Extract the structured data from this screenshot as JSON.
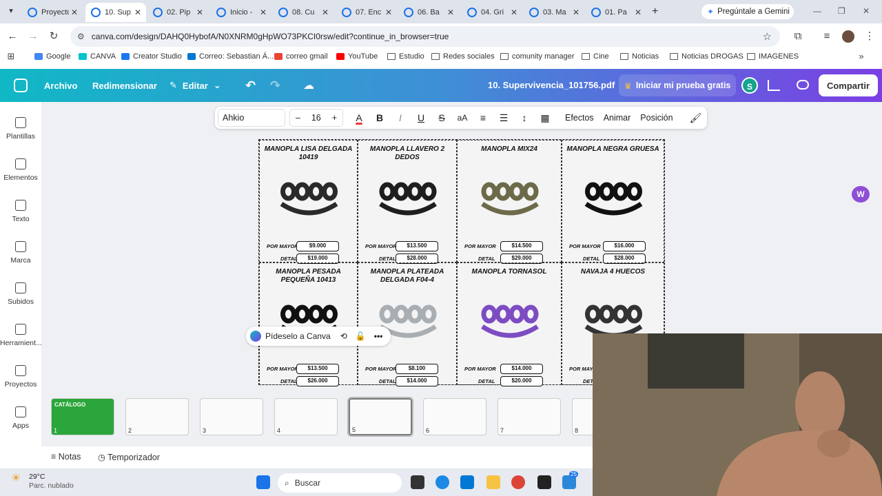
{
  "browser": {
    "tabs": [
      {
        "label": "Proyecto"
      },
      {
        "label": "10. Sup"
      },
      {
        "label": "02. Pip"
      },
      {
        "label": "Inicio -"
      },
      {
        "label": "08. Cu"
      },
      {
        "label": "07. Enc"
      },
      {
        "label": "06. Ba"
      },
      {
        "label": "04. Gri"
      },
      {
        "label": "03. Ma"
      },
      {
        "label": "01. Pa"
      }
    ],
    "gemini_label": "Pregúntale a Gemini",
    "url": "canva.com/design/DAHQ0HybofA/N0XNRM0gHpWO73PKCI0rsw/edit?continue_in_browser=true",
    "bookmarks": [
      {
        "label": "Google",
        "color": "#4285f4"
      },
      {
        "label": "CANVA",
        "color": "#00c4cc"
      },
      {
        "label": "Creator Studio",
        "color": "#1877f2"
      },
      {
        "label": "Correo: Sebastian Á...",
        "color": "#0078d4"
      },
      {
        "label": "correo gmail",
        "color": "#ea4335"
      },
      {
        "label": "YouTube",
        "color": "#ff0000"
      },
      {
        "label": "Estudio",
        "color": "folder"
      },
      {
        "label": "Redes sociales",
        "color": "folder"
      },
      {
        "label": "comunity manager",
        "color": "folder"
      },
      {
        "label": "Cine",
        "color": "folder"
      },
      {
        "label": "Noticias",
        "color": "folder"
      },
      {
        "label": "Noticias DROGAS",
        "color": "folder"
      },
      {
        "label": "IMAGENES",
        "color": "folder"
      }
    ]
  },
  "canva": {
    "menu": {
      "file": "Archivo",
      "resize": "Redimensionar",
      "edit": "Editar"
    },
    "filename": "10. Supervivencia_101756.pdf",
    "trial": "Iniciar mi prueba gratis",
    "user_initial": "S",
    "share": "Compartir",
    "sidebar": [
      {
        "label": "Plantillas",
        "icon": "templates-icon"
      },
      {
        "label": "Elementos",
        "icon": "elements-icon"
      },
      {
        "label": "Texto",
        "icon": "text-icon"
      },
      {
        "label": "Marca",
        "icon": "brand-icon"
      },
      {
        "label": "Subidos",
        "icon": "uploads-icon"
      },
      {
        "label": "Herramient...",
        "icon": "tools-icon"
      },
      {
        "label": "Proyectos",
        "icon": "projects-icon"
      },
      {
        "label": "Apps",
        "icon": "apps-icon"
      }
    ],
    "toolbar": {
      "font": "Ahkio",
      "size": "16",
      "effects": "Efectos",
      "animate": "Animar",
      "position": "Posición"
    },
    "ask_canva": "Pídeselo a Canva",
    "notes": "Notas",
    "timer": "Temporizador",
    "thumbnails": [
      "1",
      "2",
      "3",
      "4",
      "5",
      "6",
      "7",
      "8"
    ],
    "thumb1_text": "CATÁLOGO"
  },
  "catalog": {
    "label_mayor": "POR MAYOR",
    "label_detal": "DETAL",
    "products": [
      {
        "title": "MANOPLA LISA DELGADA 10419",
        "mayor": "$9.000",
        "detal": "$19.000"
      },
      {
        "title": "MANOPLA LLAVERO 2 DEDOS",
        "mayor": "$13.500",
        "detal": "$28.000"
      },
      {
        "title": "MANOPLA MIX24",
        "mayor": "$14.500",
        "detal": "$29.000"
      },
      {
        "title": "MANOPLA NEGRA GRUESA",
        "mayor": "$16.000",
        "detal": "$28.000"
      },
      {
        "title": "MANOPLA PESADA PEQUEÑA 10413",
        "mayor": "$13.500",
        "detal": "$26.000"
      },
      {
        "title": "MANOPLA PLATEADA DELGADA F04-4",
        "mayor": "$8.100",
        "detal": "$14.000"
      },
      {
        "title": "MANOPLA TORNASOL",
        "mayor": "$14.000",
        "detal": "$20.000"
      },
      {
        "title": "NAVAJA 4 HUECOS",
        "mayor": "$",
        "detal": "$"
      }
    ]
  },
  "taskbar": {
    "temp": "29°C",
    "weather": "Parc. nublado",
    "search": "Buscar",
    "badge": "25"
  }
}
